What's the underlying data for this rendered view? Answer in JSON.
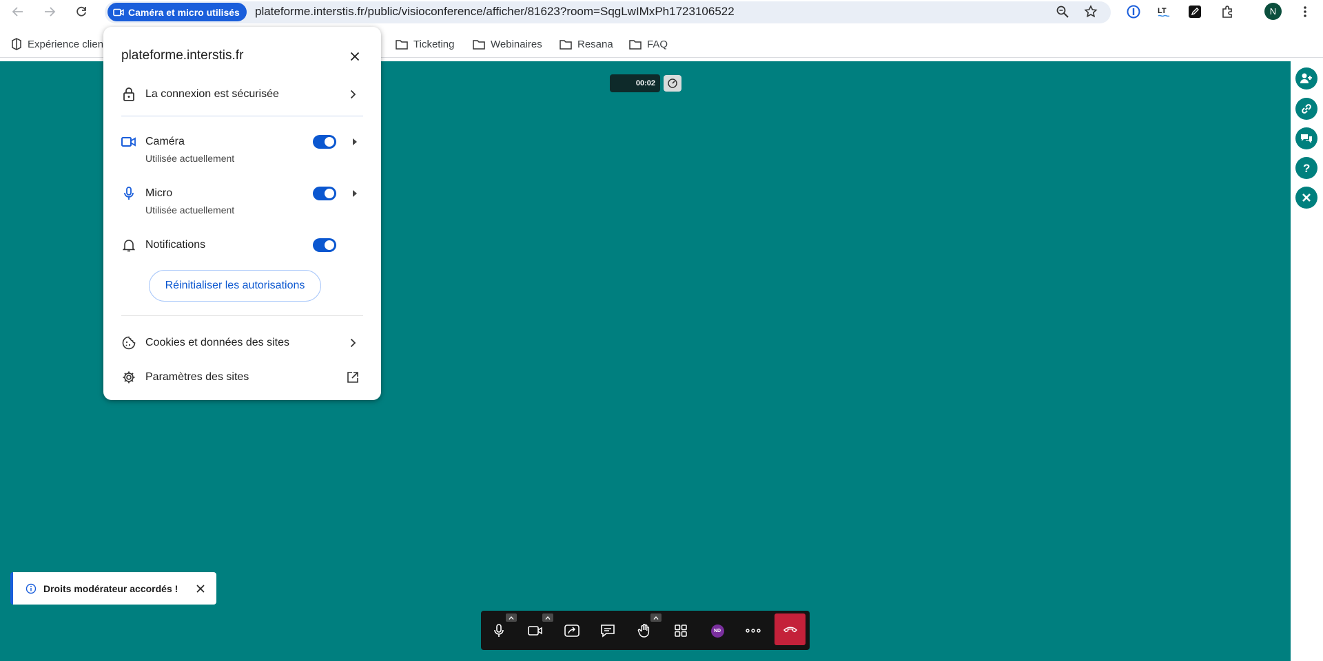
{
  "browser": {
    "permission_chip": "Caméra et micro utilisés",
    "url": "plateforme.interstis.fr/public/visioconference/afficher/81623?room=SqgLwIMxPh1723106522",
    "profile_initial": "N"
  },
  "bookmarks": [
    {
      "label": "Expérience client"
    },
    {
      "label": "Ticketing"
    },
    {
      "label": "Webinaires"
    },
    {
      "label": "Resana"
    },
    {
      "label": "FAQ"
    }
  ],
  "popup": {
    "site": "plateforme.interstis.fr",
    "connection": "La connexion est sécurisée",
    "camera": {
      "label": "Caméra",
      "status": "Utilisée actuellement",
      "enabled": true
    },
    "micro": {
      "label": "Micro",
      "status": "Utilisée actuellement",
      "enabled": true
    },
    "notifications": {
      "label": "Notifications",
      "enabled": true
    },
    "reset_button": "Réinitialiser les autorisations",
    "cookies": "Cookies et données des sites",
    "site_settings": "Paramètres des sites"
  },
  "meeting": {
    "timer": "00:02",
    "avatar_initials": "ND",
    "stage_color": "#007f7f",
    "hangup_color": "#c4213a"
  },
  "toast": {
    "message": "Droits modérateur accordés !"
  },
  "icons": {
    "rail": [
      "add-user-icon",
      "link-icon",
      "chat-icon",
      "help-icon",
      "close-icon"
    ]
  }
}
